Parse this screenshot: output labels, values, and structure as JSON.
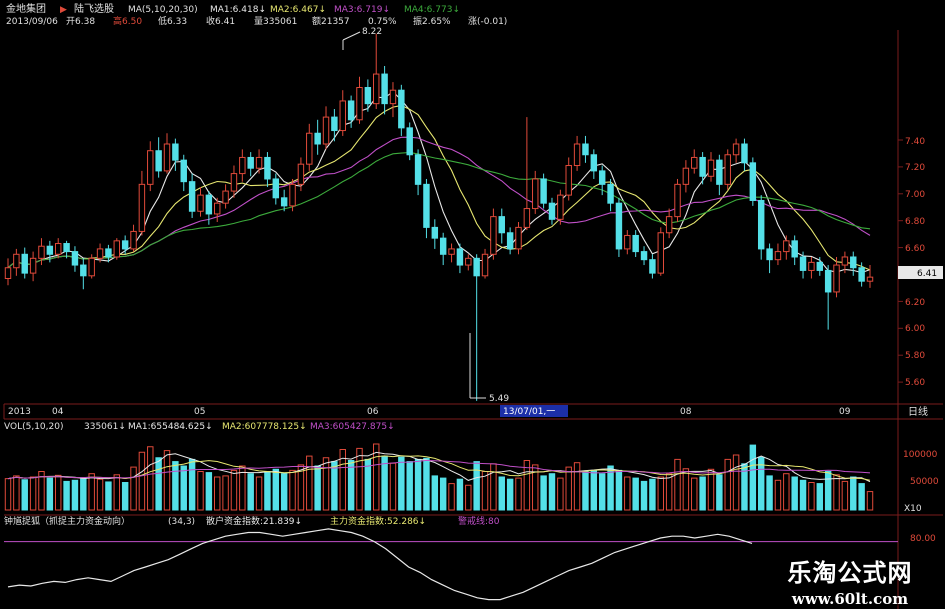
{
  "header": {
    "stock_name": "金地集团",
    "arrow": "▶",
    "indicator_name": "陆飞选股",
    "ma_params": "MA(5,10,20,30)",
    "ma1": "MA1:6.418↓",
    "ma2": "MA2:6.467↓",
    "ma3": "MA3:6.719↓",
    "ma4": "MA4:6.773↓",
    "date": "2013/09/06",
    "open": "开6.38",
    "high": "高6.50",
    "low": "低6.33",
    "close": "收6.41",
    "volume": "量335061",
    "amount": "额21357",
    "change_pct": "0.75%",
    "amplitude": "振2.65%",
    "change": "涨(-0.01)"
  },
  "price_panel": {
    "y_ticks": [
      "7.40",
      "7.20",
      "7.00",
      "6.80",
      "6.60",
      "6.40",
      "6.20",
      "6.00",
      "5.80",
      "5.60"
    ],
    "last_price_tag": "6.41",
    "max_annotation": "8.22",
    "min_annotation": "5.49"
  },
  "time_axis": {
    "labels": [
      "2013",
      "04",
      "05",
      "06",
      "07",
      "08",
      "09"
    ],
    "cursor_label": "13/07/01,一",
    "period_label": "日线"
  },
  "volume_panel": {
    "title": "VOL(5,10,20)",
    "value": "335061↓",
    "ma1": "MA1:655484.625↓",
    "ma2": "MA2:607778.125↓",
    "ma3": "MA3:605427.875↓",
    "y_ticks": [
      "100000",
      "50000"
    ],
    "unit": "X10"
  },
  "indicator_panel": {
    "title": "钟馗捉狐（抓捉主力资金动向）",
    "params": "(34,3)",
    "retail": "散户资金指数:21.839↓",
    "main": "主力资金指数:52.286↓",
    "warn_label": "警戒线:80",
    "y_tick": "80.00"
  },
  "watermark": {
    "title": "乐淘公式网",
    "url": "www.60lt.com"
  },
  "colors": {
    "up": "#e04a3a",
    "down": "#54e0e8",
    "ma1": "#e8e8e8",
    "ma2": "#e6e670",
    "ma3": "#c050c8",
    "ma4": "#3caa3c",
    "grid": "#7a1c1c",
    "warn_line": "#c050c8"
  },
  "chart_data": {
    "type": "candlestick",
    "price_scale": {
      "min": 5.49,
      "max": 8.22
    },
    "volume_scale": {
      "ticks": [
        50000,
        100000
      ],
      "unit": "X10"
    },
    "indicator_scale": {
      "warn": 80
    },
    "candles": [
      {
        "o": 6.4,
        "c": 6.48,
        "h": 6.55,
        "l": 6.35,
        "v": 57000
      },
      {
        "o": 6.48,
        "c": 6.58,
        "h": 6.62,
        "l": 6.42,
        "v": 62000
      },
      {
        "o": 6.58,
        "c": 6.44,
        "h": 6.63,
        "l": 6.4,
        "v": 55000
      },
      {
        "o": 6.44,
        "c": 6.55,
        "h": 6.6,
        "l": 6.38,
        "v": 60000
      },
      {
        "o": 6.55,
        "c": 6.64,
        "h": 6.7,
        "l": 6.5,
        "v": 70000
      },
      {
        "o": 6.64,
        "c": 6.58,
        "h": 6.68,
        "l": 6.52,
        "v": 58000
      },
      {
        "o": 6.58,
        "c": 6.66,
        "h": 6.7,
        "l": 6.55,
        "v": 63000
      },
      {
        "o": 6.66,
        "c": 6.6,
        "h": 6.68,
        "l": 6.55,
        "v": 52000
      },
      {
        "o": 6.6,
        "c": 6.5,
        "h": 6.64,
        "l": 6.45,
        "v": 54000
      },
      {
        "o": 6.5,
        "c": 6.42,
        "h": 6.55,
        "l": 6.32,
        "v": 58000
      },
      {
        "o": 6.42,
        "c": 6.55,
        "h": 6.58,
        "l": 6.4,
        "v": 66000
      },
      {
        "o": 6.55,
        "c": 6.62,
        "h": 6.66,
        "l": 6.52,
        "v": 56000
      },
      {
        "o": 6.62,
        "c": 6.56,
        "h": 6.65,
        "l": 6.52,
        "v": 51000
      },
      {
        "o": 6.56,
        "c": 6.68,
        "h": 6.7,
        "l": 6.54,
        "v": 64000
      },
      {
        "o": 6.68,
        "c": 6.62,
        "h": 6.72,
        "l": 6.58,
        "v": 50000
      },
      {
        "o": 6.62,
        "c": 6.75,
        "h": 6.8,
        "l": 6.6,
        "v": 78000
      },
      {
        "o": 6.75,
        "c": 7.1,
        "h": 7.2,
        "l": 6.72,
        "v": 105000
      },
      {
        "o": 7.1,
        "c": 7.35,
        "h": 7.42,
        "l": 7.05,
        "v": 115000
      },
      {
        "o": 7.35,
        "c": 7.2,
        "h": 7.45,
        "l": 7.15,
        "v": 95000
      },
      {
        "o": 7.2,
        "c": 7.4,
        "h": 7.48,
        "l": 7.18,
        "v": 108000
      },
      {
        "o": 7.4,
        "c": 7.28,
        "h": 7.44,
        "l": 7.2,
        "v": 88000
      },
      {
        "o": 7.28,
        "c": 7.12,
        "h": 7.32,
        "l": 7.05,
        "v": 80000
      },
      {
        "o": 7.12,
        "c": 6.9,
        "h": 7.18,
        "l": 6.85,
        "v": 92000
      },
      {
        "o": 6.9,
        "c": 7.02,
        "h": 7.08,
        "l": 6.86,
        "v": 70000
      },
      {
        "o": 7.02,
        "c": 6.88,
        "h": 7.05,
        "l": 6.8,
        "v": 68000
      },
      {
        "o": 6.88,
        "c": 6.96,
        "h": 7.0,
        "l": 6.82,
        "v": 60000
      },
      {
        "o": 6.96,
        "c": 7.05,
        "h": 7.1,
        "l": 6.92,
        "v": 62000
      },
      {
        "o": 7.05,
        "c": 7.18,
        "h": 7.24,
        "l": 7.0,
        "v": 72000
      },
      {
        "o": 7.18,
        "c": 7.3,
        "h": 7.36,
        "l": 7.12,
        "v": 80000
      },
      {
        "o": 7.3,
        "c": 7.22,
        "h": 7.34,
        "l": 7.16,
        "v": 66000
      },
      {
        "o": 7.22,
        "c": 7.3,
        "h": 7.36,
        "l": 7.18,
        "v": 60000
      },
      {
        "o": 7.3,
        "c": 7.14,
        "h": 7.34,
        "l": 7.08,
        "v": 70000
      },
      {
        "o": 7.14,
        "c": 7.0,
        "h": 7.18,
        "l": 6.95,
        "v": 74000
      },
      {
        "o": 7.0,
        "c": 6.94,
        "h": 7.06,
        "l": 6.9,
        "v": 66000
      },
      {
        "o": 6.94,
        "c": 7.1,
        "h": 7.14,
        "l": 6.9,
        "v": 72000
      },
      {
        "o": 7.1,
        "c": 7.25,
        "h": 7.3,
        "l": 7.05,
        "v": 82000
      },
      {
        "o": 7.25,
        "c": 7.48,
        "h": 7.55,
        "l": 7.2,
        "v": 98000
      },
      {
        "o": 7.48,
        "c": 7.4,
        "h": 7.58,
        "l": 7.32,
        "v": 80000
      },
      {
        "o": 7.4,
        "c": 7.6,
        "h": 7.68,
        "l": 7.36,
        "v": 95000
      },
      {
        "o": 7.6,
        "c": 7.5,
        "h": 7.66,
        "l": 7.42,
        "v": 88000
      },
      {
        "o": 7.5,
        "c": 7.72,
        "h": 7.8,
        "l": 7.46,
        "v": 110000
      },
      {
        "o": 7.72,
        "c": 7.58,
        "h": 7.76,
        "l": 7.52,
        "v": 90000
      },
      {
        "o": 7.58,
        "c": 7.82,
        "h": 7.9,
        "l": 7.55,
        "v": 112000
      },
      {
        "o": 7.82,
        "c": 7.7,
        "h": 7.88,
        "l": 7.64,
        "v": 92000
      },
      {
        "o": 7.7,
        "c": 7.92,
        "h": 8.22,
        "l": 7.66,
        "v": 120000
      },
      {
        "o": 7.92,
        "c": 7.7,
        "h": 7.98,
        "l": 7.62,
        "v": 98000
      },
      {
        "o": 7.7,
        "c": 7.8,
        "h": 7.86,
        "l": 7.6,
        "v": 85000
      },
      {
        "o": 7.8,
        "c": 7.52,
        "h": 7.84,
        "l": 7.46,
        "v": 96000
      },
      {
        "o": 7.52,
        "c": 7.32,
        "h": 7.56,
        "l": 7.28,
        "v": 88000
      },
      {
        "o": 7.32,
        "c": 7.1,
        "h": 7.36,
        "l": 7.02,
        "v": 92000
      },
      {
        "o": 7.1,
        "c": 6.78,
        "h": 7.14,
        "l": 6.7,
        "v": 94000
      },
      {
        "o": 6.78,
        "c": 6.7,
        "h": 6.84,
        "l": 6.62,
        "v": 62000
      },
      {
        "o": 6.7,
        "c": 6.58,
        "h": 6.74,
        "l": 6.5,
        "v": 58000
      },
      {
        "o": 6.58,
        "c": 6.62,
        "h": 6.66,
        "l": 6.52,
        "v": 48000
      },
      {
        "o": 6.62,
        "c": 6.5,
        "h": 6.66,
        "l": 6.44,
        "v": 56000
      },
      {
        "o": 6.5,
        "c": 6.55,
        "h": 6.58,
        "l": 6.46,
        "v": 45000
      },
      {
        "o": 6.55,
        "c": 6.42,
        "h": 6.58,
        "l": 5.49,
        "v": 88000
      },
      {
        "o": 6.42,
        "c": 6.58,
        "h": 6.62,
        "l": 6.4,
        "v": 70000
      },
      {
        "o": 6.58,
        "c": 6.86,
        "h": 6.92,
        "l": 6.54,
        "v": 84000
      },
      {
        "o": 6.86,
        "c": 6.74,
        "h": 6.92,
        "l": 6.66,
        "v": 60000
      },
      {
        "o": 6.74,
        "c": 6.62,
        "h": 6.78,
        "l": 6.58,
        "v": 56000
      },
      {
        "o": 6.62,
        "c": 6.78,
        "h": 6.82,
        "l": 6.58,
        "v": 58000
      },
      {
        "o": 6.78,
        "c": 6.92,
        "h": 7.6,
        "l": 6.76,
        "v": 90000
      },
      {
        "o": 6.92,
        "c": 7.14,
        "h": 7.2,
        "l": 6.88,
        "v": 82000
      },
      {
        "o": 7.14,
        "c": 6.96,
        "h": 7.18,
        "l": 6.92,
        "v": 62000
      },
      {
        "o": 6.96,
        "c": 6.84,
        "h": 7.0,
        "l": 6.8,
        "v": 66000
      },
      {
        "o": 6.84,
        "c": 7.02,
        "h": 7.06,
        "l": 6.8,
        "v": 58000
      },
      {
        "o": 7.02,
        "c": 7.24,
        "h": 7.3,
        "l": 6.98,
        "v": 78000
      },
      {
        "o": 7.24,
        "c": 7.4,
        "h": 7.46,
        "l": 7.2,
        "v": 86000
      },
      {
        "o": 7.4,
        "c": 7.32,
        "h": 7.46,
        "l": 7.26,
        "v": 70000
      },
      {
        "o": 7.32,
        "c": 7.2,
        "h": 7.36,
        "l": 7.14,
        "v": 72000
      },
      {
        "o": 7.2,
        "c": 7.1,
        "h": 7.24,
        "l": 7.02,
        "v": 66000
      },
      {
        "o": 7.1,
        "c": 6.96,
        "h": 7.14,
        "l": 6.9,
        "v": 80000
      },
      {
        "o": 6.96,
        "c": 6.62,
        "h": 7.0,
        "l": 6.56,
        "v": 72000
      },
      {
        "o": 6.62,
        "c": 6.72,
        "h": 6.76,
        "l": 6.58,
        "v": 60000
      },
      {
        "o": 6.72,
        "c": 6.6,
        "h": 6.76,
        "l": 6.56,
        "v": 58000
      },
      {
        "o": 6.6,
        "c": 6.54,
        "h": 6.64,
        "l": 6.5,
        "v": 52000
      },
      {
        "o": 6.54,
        "c": 6.44,
        "h": 6.58,
        "l": 6.4,
        "v": 56000
      },
      {
        "o": 6.44,
        "c": 6.74,
        "h": 6.78,
        "l": 6.42,
        "v": 60000
      },
      {
        "o": 6.74,
        "c": 6.86,
        "h": 6.92,
        "l": 6.7,
        "v": 66000
      },
      {
        "o": 6.86,
        "c": 7.1,
        "h": 7.14,
        "l": 6.82,
        "v": 92000
      },
      {
        "o": 7.1,
        "c": 7.22,
        "h": 7.28,
        "l": 7.04,
        "v": 75000
      },
      {
        "o": 7.22,
        "c": 7.3,
        "h": 7.36,
        "l": 7.18,
        "v": 58000
      },
      {
        "o": 7.3,
        "c": 7.16,
        "h": 7.34,
        "l": 7.1,
        "v": 60000
      },
      {
        "o": 7.16,
        "c": 7.28,
        "h": 7.34,
        "l": 7.12,
        "v": 74000
      },
      {
        "o": 7.28,
        "c": 7.1,
        "h": 7.32,
        "l": 7.02,
        "v": 64000
      },
      {
        "o": 7.1,
        "c": 7.32,
        "h": 7.36,
        "l": 7.06,
        "v": 92000
      },
      {
        "o": 7.32,
        "c": 7.4,
        "h": 7.44,
        "l": 7.26,
        "v": 100000
      },
      {
        "o": 7.4,
        "c": 7.26,
        "h": 7.44,
        "l": 7.2,
        "v": 84000
      },
      {
        "o": 7.26,
        "c": 6.98,
        "h": 7.3,
        "l": 6.94,
        "v": 118000
      },
      {
        "o": 6.98,
        "c": 6.62,
        "h": 7.02,
        "l": 6.54,
        "v": 96000
      },
      {
        "o": 6.62,
        "c": 6.54,
        "h": 6.66,
        "l": 6.44,
        "v": 62000
      },
      {
        "o": 6.54,
        "c": 6.6,
        "h": 6.66,
        "l": 6.5,
        "v": 54000
      },
      {
        "o": 6.6,
        "c": 6.68,
        "h": 6.72,
        "l": 6.54,
        "v": 66000
      },
      {
        "o": 6.68,
        "c": 6.56,
        "h": 6.72,
        "l": 6.5,
        "v": 60000
      },
      {
        "o": 6.56,
        "c": 6.46,
        "h": 6.6,
        "l": 6.4,
        "v": 54000
      },
      {
        "o": 6.46,
        "c": 6.52,
        "h": 6.56,
        "l": 6.4,
        "v": 50000
      },
      {
        "o": 6.52,
        "c": 6.46,
        "h": 6.56,
        "l": 6.42,
        "v": 48000
      },
      {
        "o": 6.46,
        "c": 6.3,
        "h": 6.5,
        "l": 6.02,
        "v": 70000
      },
      {
        "o": 6.3,
        "c": 6.5,
        "h": 6.56,
        "l": 6.26,
        "v": 64000
      },
      {
        "o": 6.5,
        "c": 6.56,
        "h": 6.6,
        "l": 6.44,
        "v": 52000
      },
      {
        "o": 6.56,
        "c": 6.48,
        "h": 6.6,
        "l": 6.42,
        "v": 60000
      },
      {
        "o": 6.48,
        "c": 6.38,
        "h": 6.52,
        "l": 6.34,
        "v": 48000
      },
      {
        "o": 6.38,
        "c": 6.41,
        "h": 6.5,
        "l": 6.33,
        "v": 33506
      }
    ],
    "ma_series": [
      {
        "name": "MA1",
        "period": 5
      },
      {
        "name": "MA2",
        "period": 10
      },
      {
        "name": "MA3",
        "period": 20
      },
      {
        "name": "MA4",
        "period": 30
      }
    ],
    "indicator_series": {
      "name": "主力资金指数",
      "values": [
        30,
        32,
        31,
        34,
        36,
        35,
        38,
        40,
        38,
        36,
        42,
        48,
        52,
        56,
        60,
        66,
        72,
        78,
        82,
        86,
        88,
        90,
        90,
        88,
        86,
        88,
        90,
        92,
        94,
        92,
        90,
        86,
        80,
        72,
        62,
        52,
        46,
        38,
        32,
        26,
        22,
        18,
        16,
        16,
        20,
        24,
        30,
        36,
        42,
        48,
        52,
        56,
        62,
        68,
        72,
        76,
        80,
        84,
        86,
        86,
        84,
        86,
        88,
        86,
        82,
        78
      ]
    }
  }
}
